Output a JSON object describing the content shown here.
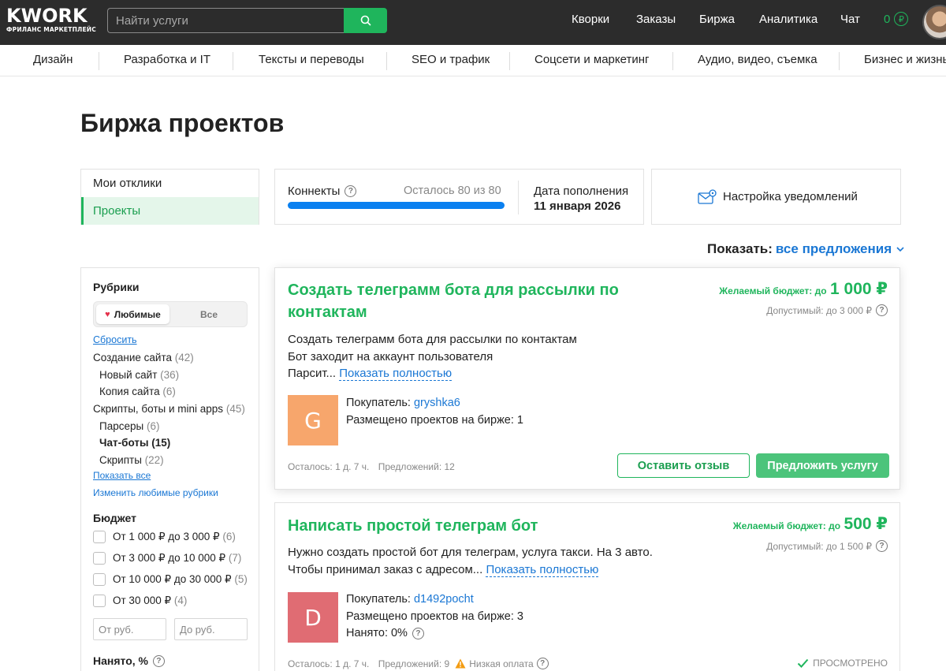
{
  "header": {
    "logo_main": "KWORK",
    "logo_sub": "ФРИЛАНС МАРКЕТПЛЕЙС",
    "search_placeholder": "Найти услуги",
    "nav": [
      "Кворки",
      "Заказы",
      "Биржа",
      "Аналитика",
      "Чат"
    ],
    "balance": "0",
    "currency": "₽"
  },
  "categories": [
    "Дизайн",
    "Разработка и IT",
    "Тексты и переводы",
    "SEO и трафик",
    "Соцсети и маркетинг",
    "Аудио, видео, съемка",
    "Бизнес и жизнь"
  ],
  "page_title": "Биржа проектов",
  "left_menu": {
    "my_responses": "Мои отклики",
    "projects": "Проекты"
  },
  "connects": {
    "label": "Коннекты",
    "remaining": "Осталось  80 из 80",
    "fill_fraction": 1.0,
    "refill_label": "Дата пополнения",
    "refill_date": "11 января 2026"
  },
  "notifications": {
    "label": "Настройка уведомлений"
  },
  "show": {
    "label": "Показать:",
    "value": "все предложения"
  },
  "filters": {
    "rubrics_title": "Рубрики",
    "toggle_fav": "Любимые",
    "toggle_all": "Все",
    "reset": "Сбросить",
    "rubrics": [
      {
        "label": "Создание сайта",
        "count": "(42)"
      },
      {
        "label": "Новый сайт",
        "count": "(36)"
      },
      {
        "label": "Копия сайта",
        "count": "(6)"
      },
      {
        "label": "Скрипты, боты и mini apps",
        "count": "(45)"
      },
      {
        "label": "Парсеры",
        "count": "(6)"
      },
      {
        "label": "Чат-боты",
        "count": "(15)"
      },
      {
        "label": "Скрипты",
        "count": "(22)"
      }
    ],
    "show_all": "Показать все",
    "edit_fav": "Изменить любимые рубрики",
    "budget_title": "Бюджет",
    "budget_options": [
      {
        "label": "От 1 000 ₽ до 3 000 ₽",
        "count": "(6)"
      },
      {
        "label": "От 3 000 ₽ до 10 000 ₽",
        "count": "(7)"
      },
      {
        "label": "От 10 000 ₽ до 30 000 ₽",
        "count": "(5)"
      },
      {
        "label": "От 30 000 ₽",
        "count": "(4)"
      }
    ],
    "from_placeholder": "От руб.",
    "to_placeholder": "До руб.",
    "hired_title": "Нанято, %"
  },
  "projects": [
    {
      "title_line1": "Создать телеграмм бота для рассылки по",
      "title_line2": "контактам",
      "budget_label": "Желаемый бюджет: до",
      "budget_value": "1 000 ₽",
      "budget_allowed": "Допустимый: до 3 000 ₽",
      "desc1": "Создать телеграмм бота для рассылки по контактам",
      "desc2": "Бот заходит на аккаунт пользователя",
      "desc3": "Парсит...",
      "more": "Показать полностью",
      "avatar_letter": "G",
      "avatar_color": "#f7a66c",
      "buyer_label": "Покупатель:",
      "buyer_name": "gryshka6",
      "posted": "Размещено проектов на бирже: 1",
      "remaining": "Осталось: 1 д. 7 ч.",
      "offers": "Предложений: 12",
      "btn_review": "Оставить отзыв",
      "btn_offer": "Предложить услугу"
    },
    {
      "title_line1": "Написать простой телеграм бот",
      "budget_label": "Желаемый бюджет: до",
      "budget_value": "500 ₽",
      "budget_allowed": "Допустимый: до 1 500 ₽",
      "desc1": "Нужно создать простой бот для телеграм, услуга такси. На 3 авто.",
      "desc2": "Чтобы принимал заказ с адресом...",
      "more": "Показать полностью",
      "avatar_letter": "D",
      "avatar_color": "#e06c73",
      "buyer_label": "Покупатель:",
      "buyer_name": "d1492pocht",
      "posted": "Размещено проектов на бирже: 3",
      "hired": "Нанято: 0%",
      "remaining": "Осталось: 1 д. 7 ч.",
      "offers": "Предложений: 9",
      "low_pay": "Низкая оплата",
      "viewed": "ПРОСМОТРЕНО"
    }
  ]
}
